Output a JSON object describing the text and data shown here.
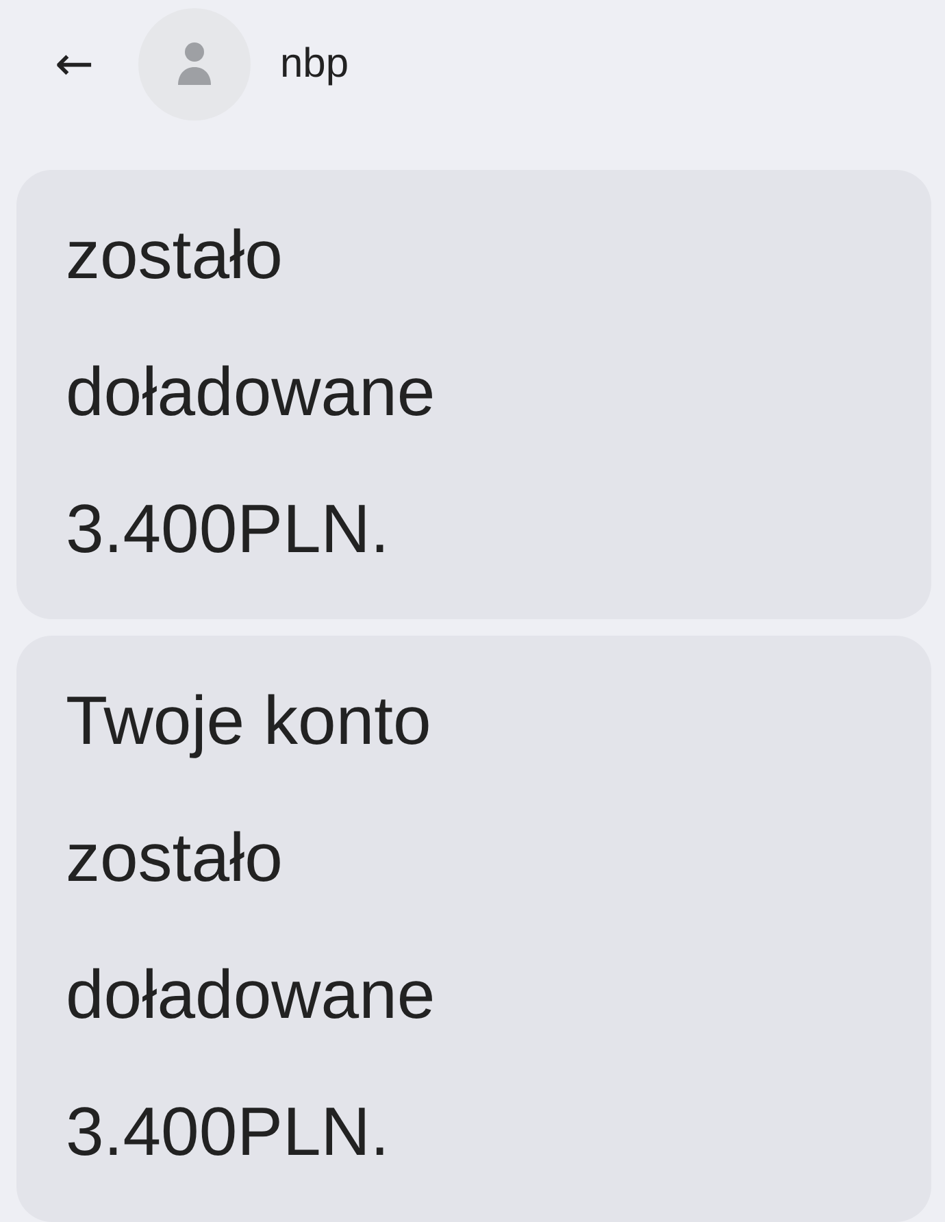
{
  "header": {
    "back": "←",
    "contact": "nbp"
  },
  "messages": [
    {
      "text": "zostało doładowane 3.400PLN."
    },
    {
      "text": "Twoje konto zostało doładowane 3.400PLN."
    }
  ]
}
